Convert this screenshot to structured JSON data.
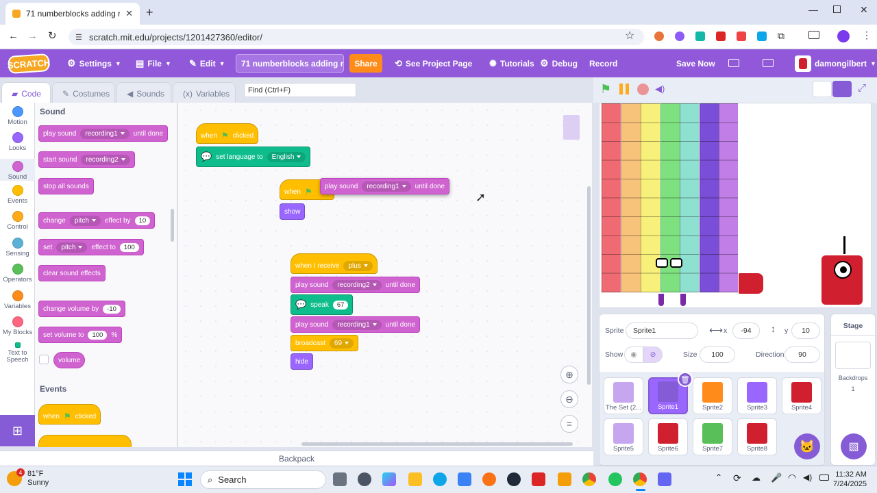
{
  "browser": {
    "tab_title": "71 numberblocks adding remi",
    "url": "scratch.mit.edu/projects/1201427360/editor/"
  },
  "menu": {
    "logo": "SCRATCH",
    "settings": "Settings",
    "file": "File",
    "edit": "Edit",
    "project_title": "71 numberblocks adding r...",
    "share": "Share",
    "see_project_page": "See Project Page",
    "tutorials": "Tutorials",
    "debug": "Debug",
    "record": "Record",
    "save_now": "Save Now",
    "username": "damongilbert"
  },
  "editor_tabs": {
    "code": "Code",
    "costumes": "Costumes",
    "sounds": "Sounds",
    "variables": "Variables",
    "find_placeholder": "Find (Ctrl+F)"
  },
  "categories": [
    {
      "label": "Motion",
      "color": "#4c97ff"
    },
    {
      "label": "Looks",
      "color": "#9966ff"
    },
    {
      "label": "Sound",
      "color": "#cf63cf"
    },
    {
      "label": "Events",
      "color": "#ffbf00"
    },
    {
      "label": "Control",
      "color": "#ffab19"
    },
    {
      "label": "Sensing",
      "color": "#5cb1d6"
    },
    {
      "label": "Operators",
      "color": "#59c059"
    },
    {
      "label": "Variables",
      "color": "#ff8c1a"
    },
    {
      "label": "My Blocks",
      "color": "#ff6680"
    },
    {
      "label": "Text to Speech",
      "color": "#0fbd8c"
    }
  ],
  "palette": {
    "sound_heading": "Sound",
    "play_sound": "play sound",
    "recording1": "recording1",
    "until_done": "until done",
    "start_sound": "start sound",
    "recording2": "recording2",
    "stop_all_sounds": "stop all sounds",
    "change": "change",
    "pitch": "pitch",
    "effect_by": "effect by",
    "change_val": "10",
    "set": "set",
    "effect_to": "effect to",
    "set_val": "100",
    "clear_sound_effects": "clear sound effects",
    "change_volume_by": "change volume by",
    "volume_change_val": "-10",
    "set_volume_to": "set volume to",
    "volume_set_val": "100",
    "percent": "%",
    "volume": "volume",
    "events_heading": "Events",
    "when": "when",
    "clicked": "clicked"
  },
  "scripts": {
    "when": "when",
    "clicked": "clicked",
    "set_language_to": "set language to",
    "english": "English",
    "play_sound": "play sound",
    "recording1": "recording1",
    "recording2": "recording2",
    "until_done": "until done",
    "show": "show",
    "when_i_receive": "when I receive",
    "plus": "plus",
    "speak": "speak",
    "speak_val": "67",
    "broadcast": "broadcast",
    "broadcast_val": "69",
    "hide": "hide"
  },
  "backpack": "Backpack",
  "sprite_info": {
    "sprite_label": "Sprite",
    "sprite_name": "Sprite1",
    "x_label": "x",
    "x": "-94",
    "y_label": "y",
    "y": "10",
    "show_label": "Show",
    "size_label": "Size",
    "size": "100",
    "direction_label": "Direction",
    "direction": "90"
  },
  "sprites": [
    {
      "name": "The Set (2...",
      "color": "#c7a6f0",
      "selected": false
    },
    {
      "name": "Sprite1",
      "color": "#855cd6",
      "selected": true
    },
    {
      "name": "Sprite2",
      "color": "#ff8c1a",
      "selected": false
    },
    {
      "name": "Sprite3",
      "color": "#9966ff",
      "selected": false
    },
    {
      "name": "Sprite4",
      "color": "#d01f2e",
      "selected": false
    },
    {
      "name": "Sprite5",
      "color": "#c7a6f0",
      "selected": false
    },
    {
      "name": "Sprite6",
      "color": "#d01f2e",
      "selected": false
    },
    {
      "name": "Sprite7",
      "color": "#59c059",
      "selected": false
    },
    {
      "name": "Sprite8",
      "color": "#d01f2e",
      "selected": false
    }
  ],
  "stage_panel": {
    "title": "Stage",
    "backdrops_label": "Backdrops",
    "backdrops_count": "1"
  },
  "taskbar": {
    "temp": "81°F",
    "weather": "Sunny",
    "badge": "4",
    "search": "Search",
    "time": "11:32 AM",
    "date": "7/24/2025"
  },
  "stage_columns": [
    "#f06a74",
    "#f7c27a",
    "#f7f07a",
    "#7ee07e",
    "#8ee0d0",
    "#7a4ed6",
    "#c07ee6"
  ]
}
